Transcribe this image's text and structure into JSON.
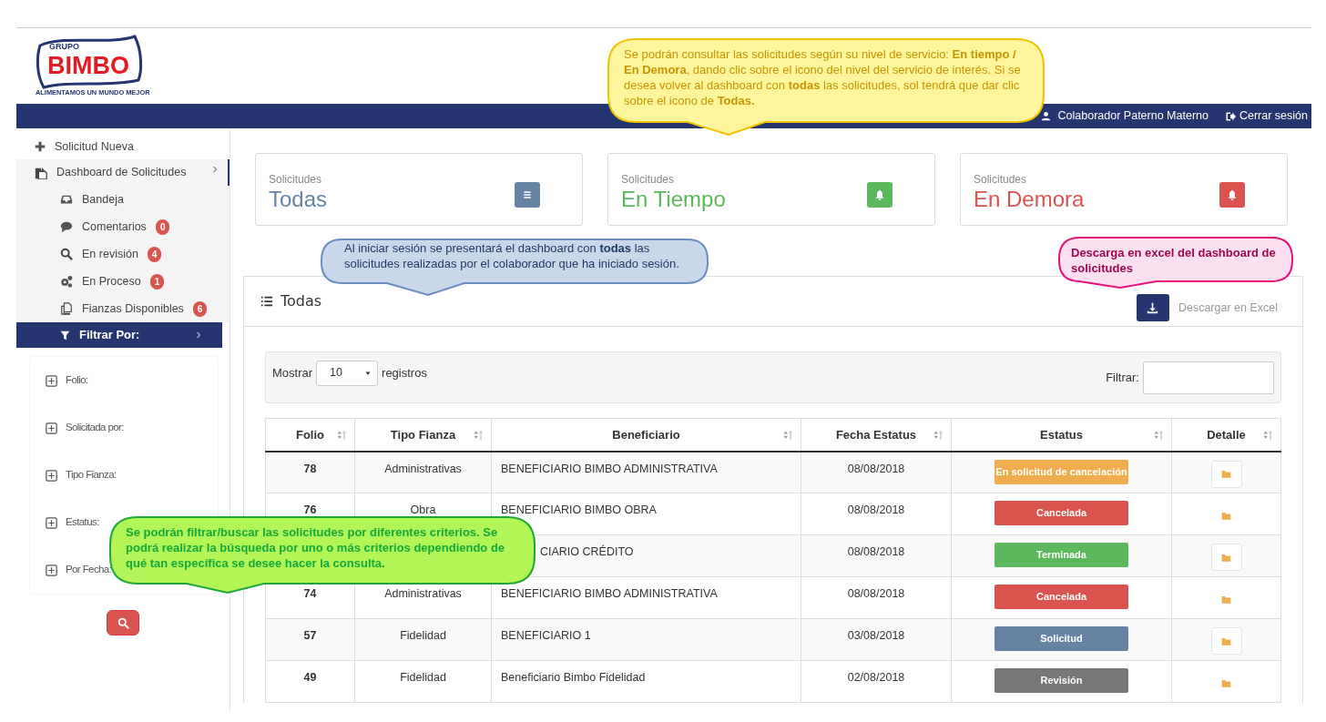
{
  "logo": {
    "top": "GRUPO",
    "name": "BIMBO",
    "tagline": "ALIMENTAMOS UN MUNDO MEJOR"
  },
  "navbar": {
    "user": "Colaborador Paterno Materno",
    "logout": "Cerrar sesión"
  },
  "sidebar": {
    "new_request": "Solicitud Nueva",
    "dashboard": {
      "label": "Dashboard de Solicitudes",
      "expanded": true,
      "children": [
        {
          "label": "Bandeja"
        },
        {
          "label": "Comentarios",
          "count": "0"
        },
        {
          "label": "En revisión",
          "count": "4"
        },
        {
          "label": "En Proceso",
          "count": "1"
        },
        {
          "label": "Fianzas Disponibles",
          "count": "6"
        }
      ]
    },
    "filter": {
      "label": "Filtrar Por:",
      "fields": [
        "Folio:",
        "Solicitada por:",
        "Tipo Fianza:",
        "Estatus:",
        "Por Fecha:"
      ]
    }
  },
  "cards": [
    {
      "label": "Solicitudes",
      "title": "Todas",
      "color": "#6783a3"
    },
    {
      "label": "Solicitudes",
      "title": "En Tiempo",
      "color": "#5cb85c"
    },
    {
      "label": "Solicitudes",
      "title": "En Demora",
      "color": "#d9534f"
    }
  ],
  "panel": {
    "title": "Todas",
    "download": "Descargar en Excel",
    "show_label": "Mostrar",
    "page_size": "10",
    "records_label": "registros",
    "filter_label": "Filtrar:"
  },
  "table": {
    "columns": [
      "Folio",
      "Tipo Fianza",
      "Beneficiario",
      "Fecha Estatus",
      "Estatus",
      "Detalle"
    ],
    "rows": [
      {
        "folio": "78",
        "tipo": "Administrativas",
        "beneficiario": "BENEFICIARIO BIMBO ADMINISTRATIVA",
        "fecha": "08/08/2018",
        "estatus": "En solicitud de cancelación",
        "color": "#f0ad4e",
        "framed": true
      },
      {
        "folio": "76",
        "tipo": "Obra",
        "beneficiario": "BENEFICIARIO BIMBO OBRA",
        "fecha": "08/08/2018",
        "estatus": "Cancelada",
        "color": "#d9534f",
        "framed": false
      },
      {
        "beneficiario": "CIARIO CRÉDITO",
        "fecha": "08/08/2018",
        "estatus": "Terminada",
        "color": "#5cb85c",
        "framed": true
      },
      {
        "folio": "74",
        "tipo": "Administrativas",
        "beneficiario": "BENEFICIARIO BIMBO ADMINISTRATIVA",
        "fecha": "08/08/2018",
        "estatus": "Cancelada",
        "color": "#d9534f",
        "framed": false
      },
      {
        "folio": "57",
        "tipo": "Fidelidad",
        "beneficiario": "BENEFICIARIO 1",
        "fecha": "03/08/2018",
        "estatus": "Solicitud",
        "color": "#6783a3",
        "framed": true
      },
      {
        "folio": "49",
        "tipo": "Fidelidad",
        "beneficiario": "Beneficiario Bimbo Fidelidad",
        "fecha": "02/08/2018",
        "estatus": "Revisión",
        "color": "#777777",
        "framed": false
      }
    ]
  },
  "notes": [
    {
      "text": "Se podrán consultar las solicitudes según su nivel de servicio: **En tiempo / En Demora**, dando clic sobre el icono del nivel del servicio de interés. Si se desea volver al dashboard con **todas** las solicitudes, sol tendrá que dar clic sobre el icono de **Todas.**",
      "color": "#fff59d"
    },
    {
      "text": "Al iniciar sesión se presentará el dashboard con **todas** las solicitudes realizadas por el colaborador que ha iniciado sesión.",
      "color": "#c9d7ea"
    },
    {
      "text": "Descarga en excel del dashboard de solicitudes",
      "color": "#fde0f0"
    },
    {
      "text": "Se podrán filtrar/buscar las solicitudes por diferentes criterios. Se podrá realizar la búsqueda por uno o más criterios dependiendo de qué tan específica se desee hacer la consulta.",
      "color": "#b2f556"
    }
  ]
}
